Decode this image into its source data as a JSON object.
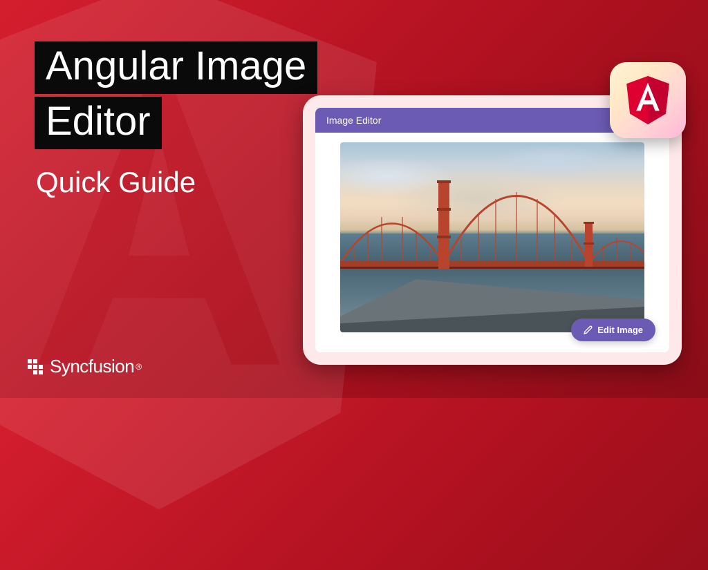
{
  "title": {
    "line1": "Angular Image",
    "line2": "Editor"
  },
  "subtitle": "Quick Guide",
  "brand": {
    "name": "Syncfusion",
    "registered": "®"
  },
  "app": {
    "header_title": "Image Editor",
    "edit_button_label": "Edit Image"
  },
  "colors": {
    "primary": "#6b5bb5",
    "background_red": "#d41e2e"
  }
}
